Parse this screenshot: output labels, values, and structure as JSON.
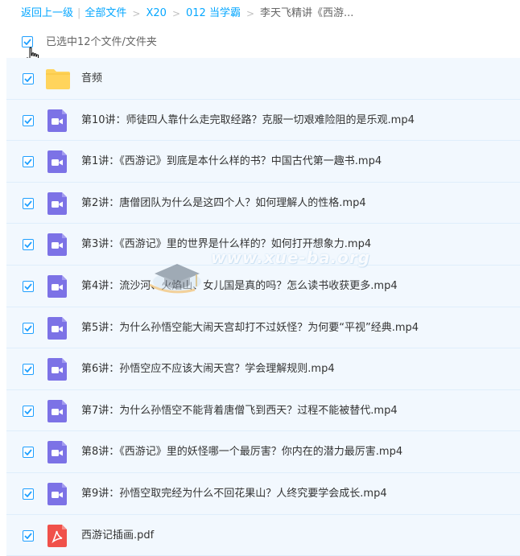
{
  "breadcrumb": {
    "back": "返回上一级",
    "all_files": "全部文件",
    "path": [
      "X20",
      "012 当学霸"
    ],
    "current": "李天飞精讲《西游..."
  },
  "selection": {
    "text": "已选中12个文件/文件夹",
    "checked": true
  },
  "files": [
    {
      "name": "音频",
      "type": "folder",
      "checked": true
    },
    {
      "name": "第10讲：师徒四人靠什么走完取经路？克服一切艰难险阻的是乐观.mp4",
      "type": "video",
      "checked": true
    },
    {
      "name": "第1讲：《西游记》到底是本什么样的书？中国古代第一趣书.mp4",
      "type": "video",
      "checked": true
    },
    {
      "name": "第2讲：唐僧团队为什么是这四个人？如何理解人的性格.mp4",
      "type": "video",
      "checked": true
    },
    {
      "name": "第3讲：《西游记》里的世界是什么样的？如何打开想象力.mp4",
      "type": "video",
      "checked": true
    },
    {
      "name": "第4讲：流沙河、火焰山、女儿国是真的吗？怎么读书收获更多.mp4",
      "type": "video",
      "checked": true
    },
    {
      "name": "第5讲：为什么孙悟空能大闹天宫却打不过妖怪？为何要“平视”经典.mp4",
      "type": "video",
      "checked": true
    },
    {
      "name": "第6讲：孙悟空应不应该大闹天宫？学会理解规则.mp4",
      "type": "video",
      "checked": true
    },
    {
      "name": "第7讲：为什么孙悟空不能背着唐僧飞到西天？过程不能被替代.mp4",
      "type": "video",
      "checked": true
    },
    {
      "name": "第8讲：《西游记》里的妖怪哪一个最厉害？你内在的潜力最厉害.mp4",
      "type": "video",
      "checked": true
    },
    {
      "name": "第9讲：孙悟空取完经为什么不回花果山？人终究要学会成长.mp4",
      "type": "video",
      "checked": true
    },
    {
      "name": "西游记插画.pdf",
      "type": "pdf",
      "checked": true
    }
  ],
  "watermark": {
    "text": "www.xue-ba.org"
  },
  "colors": {
    "link": "#06a7ff",
    "checkbox": "#1e9fff",
    "row_bg": "#f2f8fe",
    "folder": "#ffd45c",
    "video": "#7c72e6",
    "pdf": "#f0514a"
  }
}
